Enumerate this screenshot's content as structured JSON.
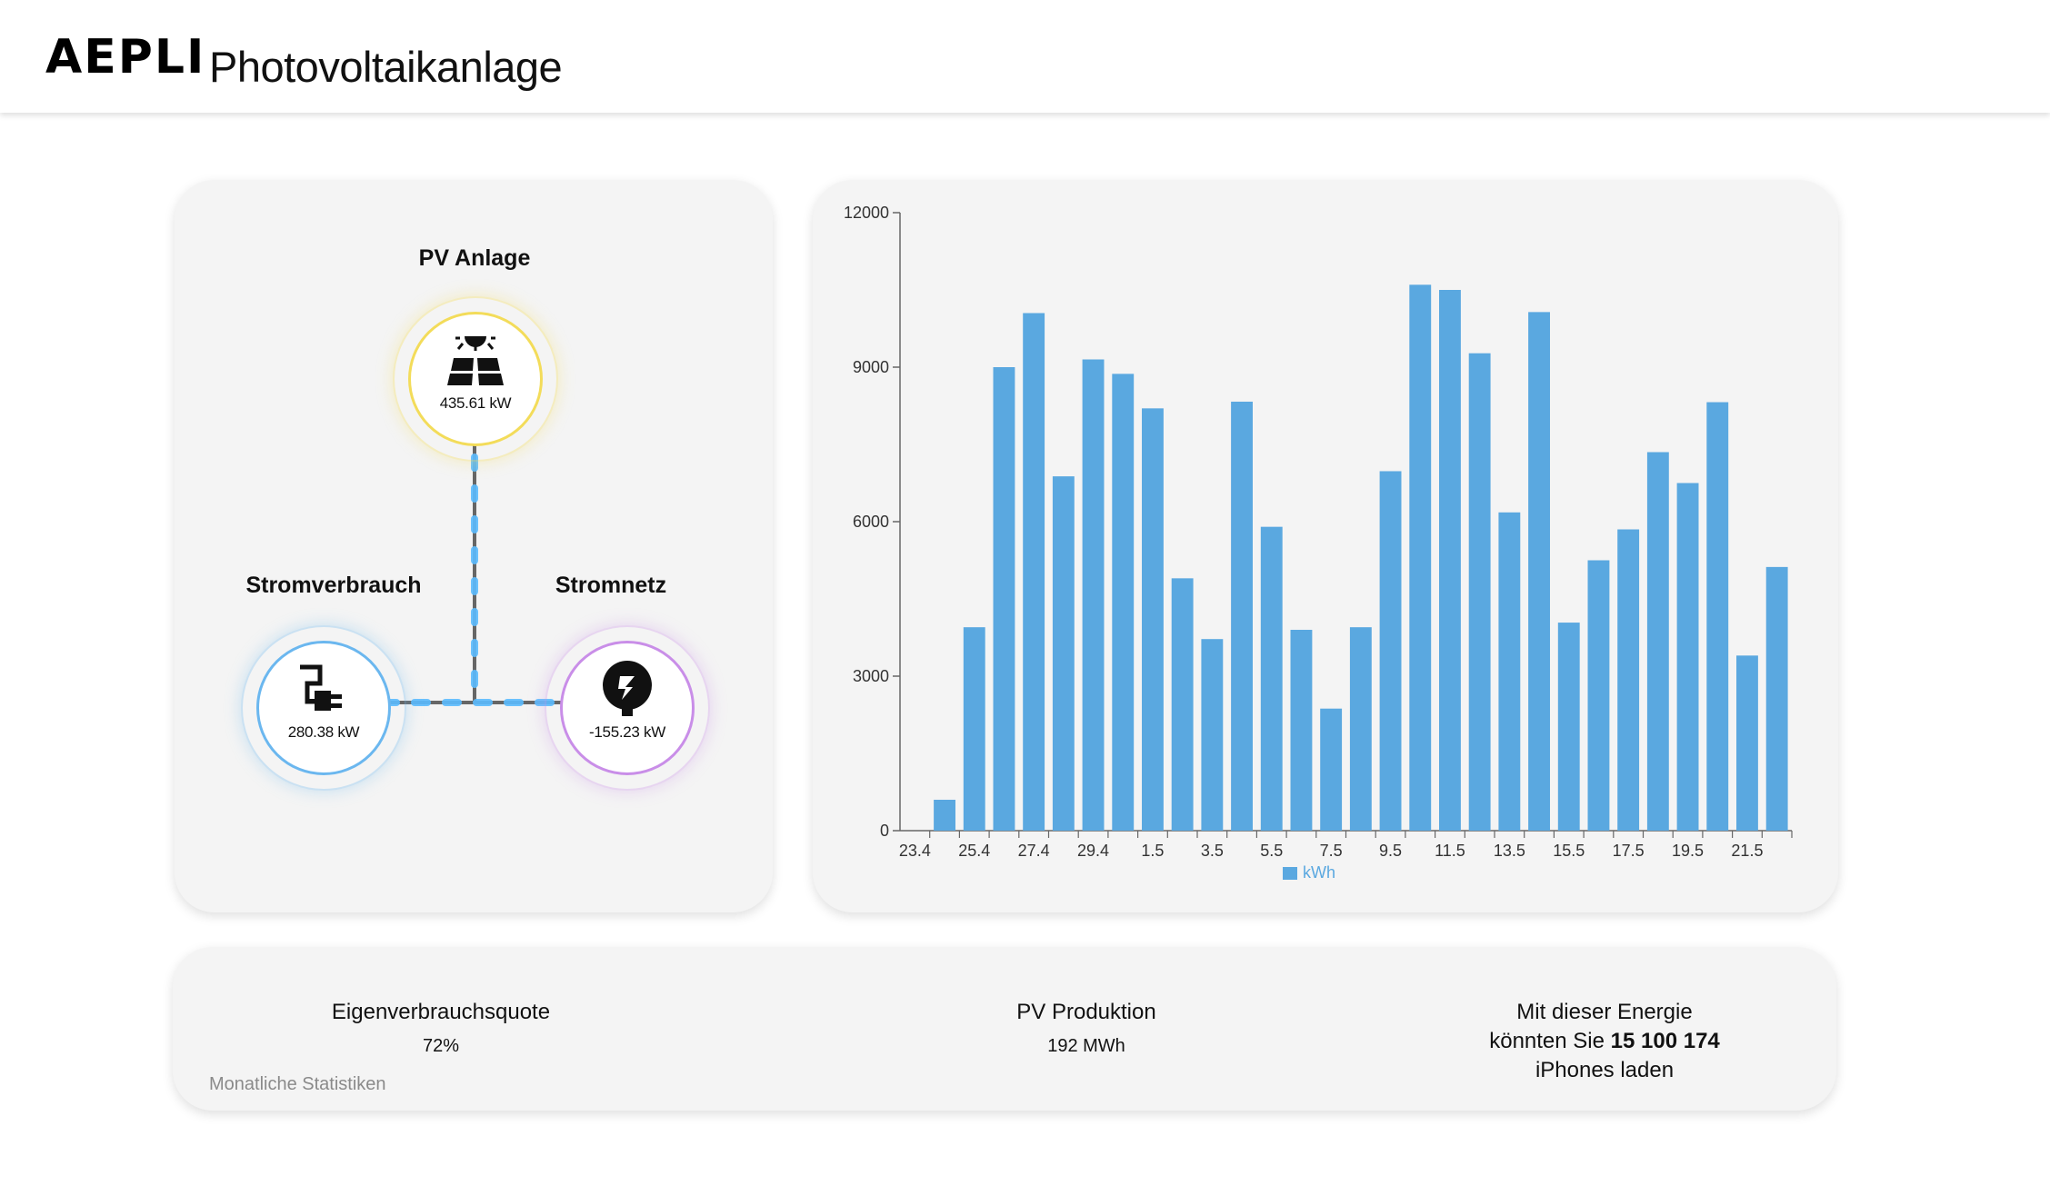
{
  "header": {
    "logo": "AEPLI",
    "title": "Photovoltaikanlage"
  },
  "flow": {
    "pv": {
      "label": "PV Anlage",
      "value": "435.61 kW",
      "icon": "solar-panel-icon",
      "color": "#f3dc5a"
    },
    "consumption": {
      "label": "Stromverbrauch",
      "value": "280.38 kW",
      "icon": "plug-icon",
      "color": "#6bb7ef"
    },
    "grid": {
      "label": "Stromnetz",
      "value": "-155.23 kW",
      "icon": "grid-pylon-icon",
      "color": "#c98ee8"
    },
    "line_color": "#666666",
    "dash_color": "#5cbcff"
  },
  "chart_data": {
    "type": "bar",
    "categories": [
      "23.4",
      "24.4",
      "25.4",
      "26.4",
      "27.4",
      "28.4",
      "29.4",
      "30.4",
      "1.5",
      "2.5",
      "3.5",
      "4.5",
      "5.5",
      "6.5",
      "7.5",
      "8.5",
      "9.5",
      "10.5",
      "11.5",
      "12.5",
      "13.5",
      "14.5",
      "15.5",
      "16.5",
      "17.5",
      "18.5",
      "19.5",
      "20.5",
      "21.5",
      "22.5"
    ],
    "tick_labels": [
      "23.4",
      "25.4",
      "27.4",
      "29.4",
      "1.5",
      "3.5",
      "5.5",
      "7.5",
      "9.5",
      "11.5",
      "13.5",
      "15.5",
      "17.5",
      "19.5",
      "21.5"
    ],
    "series": [
      {
        "name": "kWh",
        "values": [
          0,
          600,
          3950,
          9000,
          10050,
          6880,
          9150,
          8870,
          8200,
          4900,
          3720,
          8330,
          5900,
          3900,
          2370,
          3950,
          6980,
          10600,
          10500,
          9270,
          6180,
          10070,
          4040,
          5250,
          5850,
          7350,
          6750,
          8320,
          3400,
          5120
        ]
      }
    ],
    "yticks": [
      0,
      3000,
      6000,
      9000,
      12000
    ],
    "ylim": [
      0,
      12000
    ],
    "color": "#5aa8e0",
    "legend": "bottom-center"
  },
  "stats": {
    "self_consumption": {
      "title": "Eigenverbrauchsquote",
      "value": "72%"
    },
    "pv_production": {
      "title": "PV Produktion",
      "value": "192 MWh"
    },
    "energy": {
      "line1": "Mit dieser Energie",
      "line2_prefix": "könnten Sie ",
      "line2_number": "15 100 174",
      "line3": "iPhones laden"
    },
    "footnote": "Monatliche Statistiken"
  }
}
